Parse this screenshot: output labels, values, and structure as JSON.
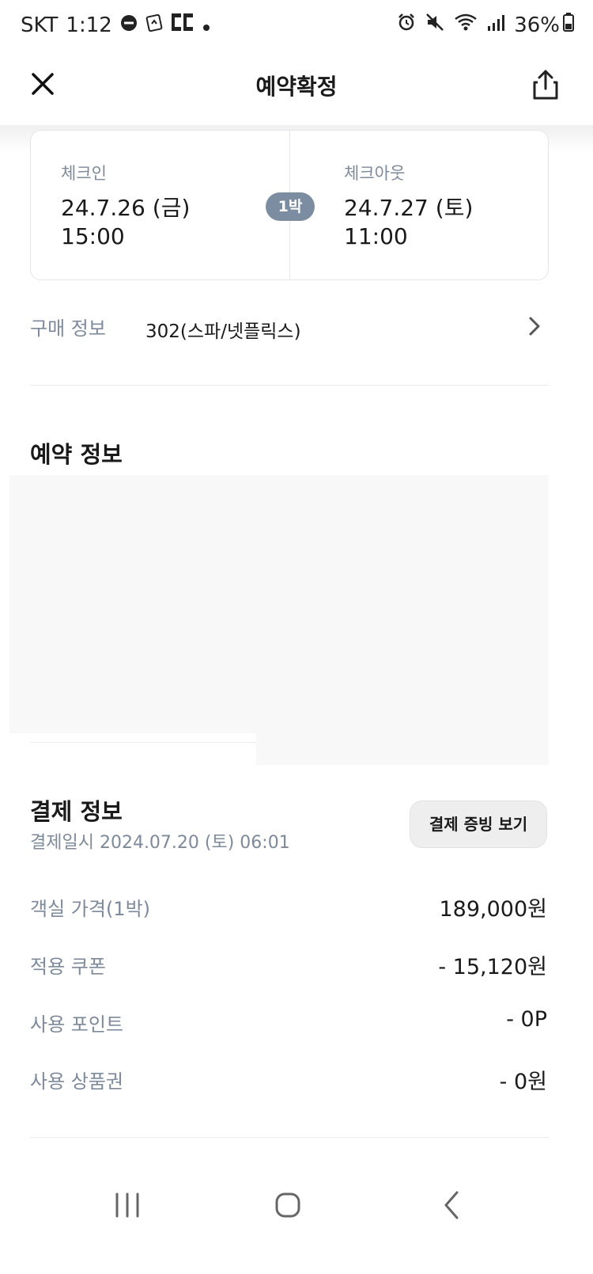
{
  "status_bar": {
    "carrier": "SKT",
    "time": "1:12",
    "battery": "36%",
    "icons_left": [
      "dnd-icon",
      "app-notification-icon",
      "app-notification-icon",
      "dot-icon"
    ],
    "icons_right": [
      "alarm-icon",
      "mute-icon",
      "wifi-icon",
      "signal-icon",
      "battery-icon"
    ]
  },
  "header": {
    "title": "예약확정"
  },
  "checkin": {
    "label": "체크인",
    "date": "24.7.26 (금)",
    "time": "15:00"
  },
  "checkout": {
    "label": "체크아웃",
    "date": "24.7.27 (토)",
    "time": "11:00"
  },
  "nights": "1박",
  "purchase": {
    "label": "구매 정보",
    "value": "302(스파/넷플릭스)"
  },
  "reservation_section": {
    "title": "예약 정보"
  },
  "payment": {
    "title": "결제 정보",
    "date": "결제일시 2024.07.20 (토) 06:01",
    "receipt_button": "결제 증빙 보기",
    "rows": [
      {
        "label": "객실 가격(1박)",
        "value": "189,000원"
      },
      {
        "label": "적용 쿠폰",
        "value": "- 15,120원"
      },
      {
        "label": "사용 포인트",
        "value": "- 0P"
      },
      {
        "label": "사용 상품권",
        "value": "- 0원"
      }
    ]
  },
  "colors": {
    "label_gray": "#7d8a9c",
    "badge": "#7d8da1",
    "border": "#e3e5e8"
  }
}
